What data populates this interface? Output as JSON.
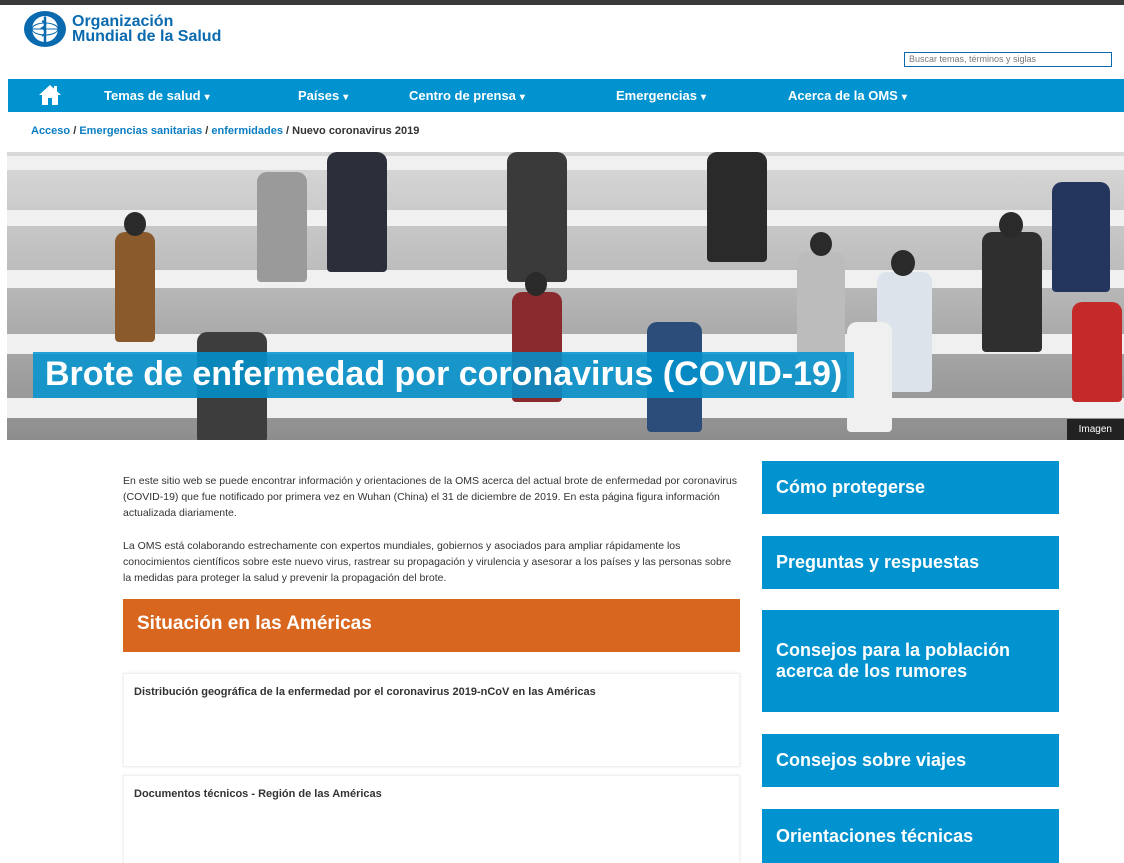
{
  "header": {
    "logo_line1": "Organización",
    "logo_line2": "Mundial de la Salud",
    "search_placeholder": "Buscar temas, términos y siglas"
  },
  "nav": {
    "home_icon": "home-icon",
    "items": [
      {
        "label": "Temas de salud"
      },
      {
        "label": "Países"
      },
      {
        "label": "Centro de prensa"
      },
      {
        "label": "Emergencias"
      },
      {
        "label": "Acerca de la OMS"
      }
    ],
    "chevron": "⌄"
  },
  "breadcrumb": {
    "items": [
      "Acceso",
      "Emergencias sanitarias",
      "enfermidades"
    ],
    "separator": "/",
    "current": "Nuevo coronavirus 2019"
  },
  "hero": {
    "title": "Brote de enfermedad por coronavirus (COVID-19)",
    "credit": "Imagen"
  },
  "main": {
    "intro_paragraphs": [
      "En este sitio web se puede encontrar información y orientaciones de la OMS acerca del actual brote de enfermedad por coronavirus (COVID-19) que fue notificado por primera vez en Wuhan (China) el 31 de diciembre de 2019. En esta página figura información actualizada diariamente.",
      "La OMS está colaborando estrechamente con expertos mundiales, gobiernos y asociados para ampliar rápidamente los conocimientos científicos sobre este nuevo virus, rastrear su propagación y virulencia y asesorar a los países y las personas sobre la medidas para proteger la salud y prevenir la propagación del brote."
    ],
    "situation_title": "Situación en las Américas",
    "cards": [
      {
        "title": "Distribución geográfica de la enfermedad por el coronavirus 2019-nCoV en las Américas"
      },
      {
        "title": "Documentos técnicos - Región de las Américas"
      }
    ]
  },
  "sidebar": {
    "buttons": [
      {
        "label": "Cómo protegerse"
      },
      {
        "label": "Preguntas y respuestas"
      },
      {
        "label": "Consejos para la población acerca de los rumores"
      },
      {
        "label": "Consejos sobre viajes"
      },
      {
        "label": "Orientaciones técnicas"
      }
    ]
  },
  "colors": {
    "nav_blue": "#0093d0",
    "link_blue": "#0a7cc1",
    "orange": "#d9661f"
  }
}
